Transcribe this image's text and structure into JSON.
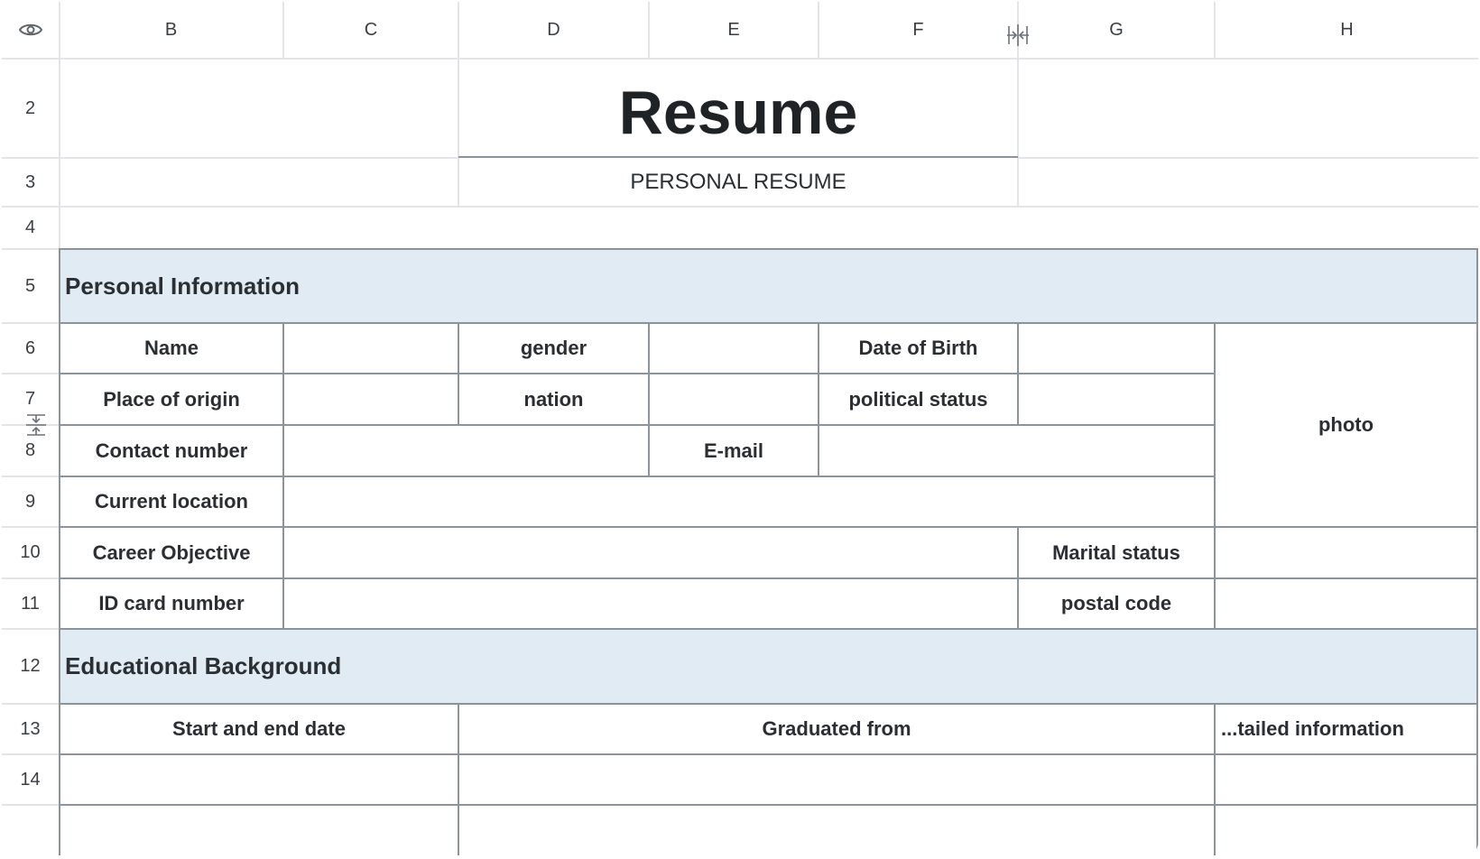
{
  "col_headers": [
    "B",
    "C",
    "D",
    "E",
    "F",
    "G",
    "H"
  ],
  "row_headers": [
    "2",
    "3",
    "4",
    "5",
    "6",
    "7",
    "8",
    "9",
    "10",
    "11",
    "12",
    "13",
    "14"
  ],
  "title": "Resume",
  "subtitle": "PERSONAL RESUME",
  "sections": {
    "personal": "Personal Information",
    "education": "Educational Background"
  },
  "labels": {
    "name": "Name",
    "gender": "gender",
    "date_of_birth": "Date of Birth",
    "place_of_origin": "Place of origin",
    "nation": "nation",
    "political_status": "political status",
    "contact_number": "Contact number",
    "email": "E-mail",
    "current_location": "Current location",
    "career_objective": "Career Objective",
    "marital_status": "Marital status",
    "id_card_number": "ID card number",
    "postal_code": "postal code",
    "photo": "photo",
    "start_end_date": "Start and end date",
    "graduated_from": "Graduated from",
    "detailed_information": "...tailed information"
  },
  "icons": {
    "header_corner": "eye-icon",
    "column_resize": "column-resize-icon",
    "row_resize": "row-resize-icon"
  }
}
